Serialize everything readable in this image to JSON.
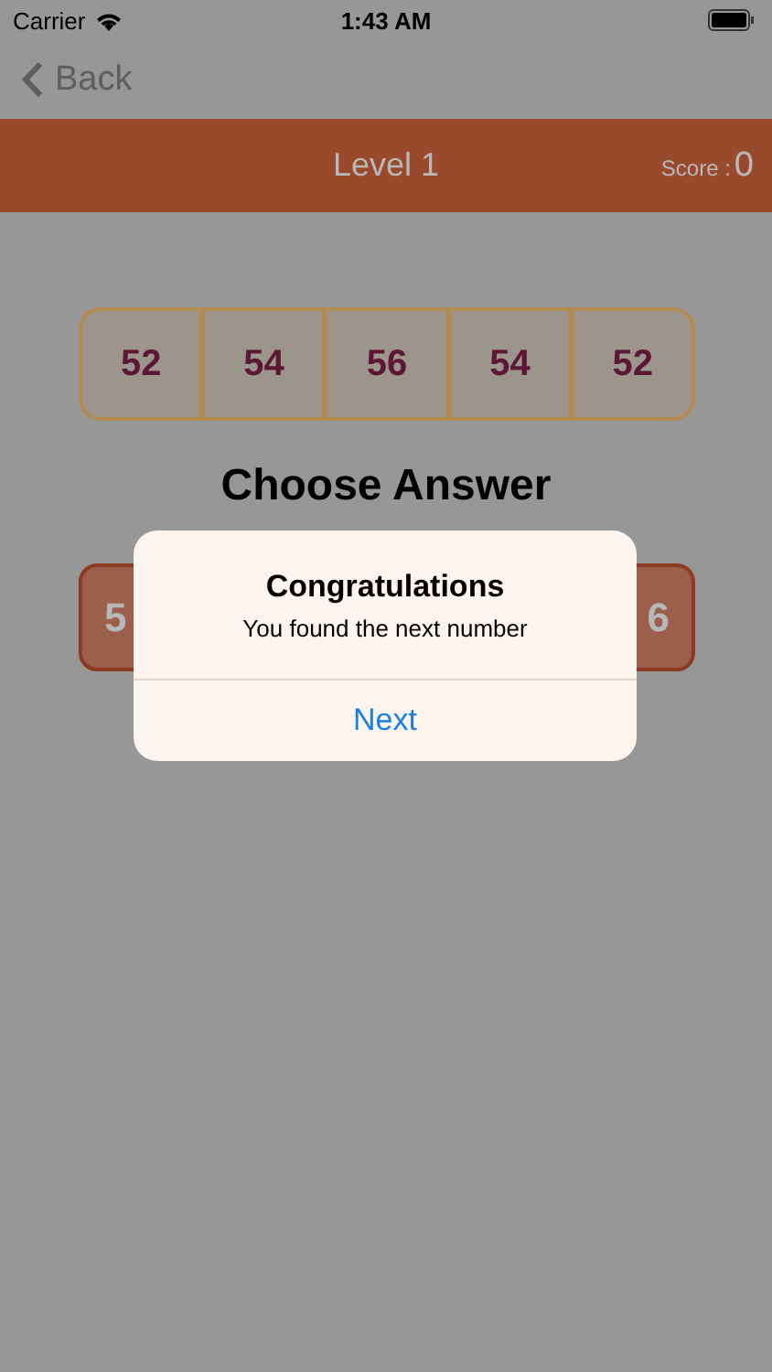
{
  "status_bar": {
    "carrier": "Carrier",
    "time": "1:43 AM"
  },
  "nav": {
    "back": "Back"
  },
  "header": {
    "title": "Level 1",
    "score_label": "Score : ",
    "score": "0"
  },
  "sequence": [
    "52",
    "54",
    "56",
    "54",
    "52"
  ],
  "prompt": "Choose Answer",
  "answers": [
    "5",
    "6"
  ],
  "alert": {
    "title": "Congratulations",
    "message": "You found the next number",
    "button": "Next"
  }
}
